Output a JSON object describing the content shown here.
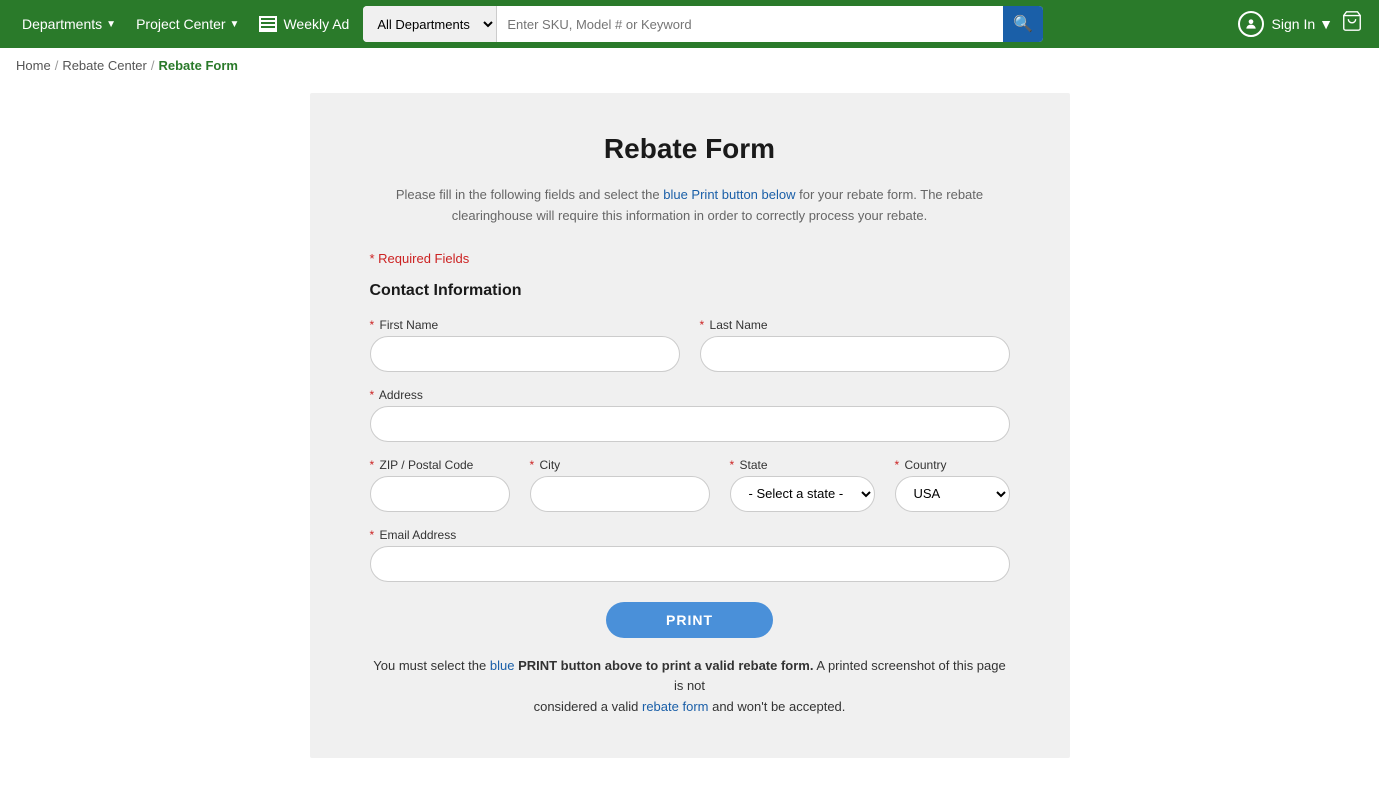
{
  "header": {
    "departments_label": "Departments",
    "project_center_label": "Project Center",
    "weekly_ad_label": "Weekly Ad",
    "search_placeholder": "Enter SKU, Model # or Keyword",
    "dept_select_default": "All Departments",
    "sign_in_label": "Sign In",
    "cart_icon": "🛒"
  },
  "breadcrumb": {
    "home_label": "Home",
    "rebate_center_label": "Rebate Center",
    "current_label": "Rebate Form"
  },
  "form": {
    "title": "Rebate Form",
    "subtitle_line1": "Please fill in the following fields and select the blue Print button below for your rebate form. The rebate",
    "subtitle_line2": "clearinghouse will require this information in order to correctly process your rebate.",
    "required_note": "* Required Fields",
    "section_title": "Contact Information",
    "first_name_label": "First Name",
    "last_name_label": "Last Name",
    "address_label": "Address",
    "zip_label": "ZIP / Postal Code",
    "city_label": "City",
    "state_label": "State",
    "country_label": "Country",
    "email_label": "Email Address",
    "state_default": "- Select a state -",
    "country_default": "USA",
    "print_button_label": "PRINT",
    "footer_note_part1": "You must select the blue ",
    "footer_note_bold": "PRINT button above to print a valid rebate form.",
    "footer_note_part2": " A printed screenshot of this page is not",
    "footer_note_part3": "considered a valid rebate form and won't be accepted."
  }
}
